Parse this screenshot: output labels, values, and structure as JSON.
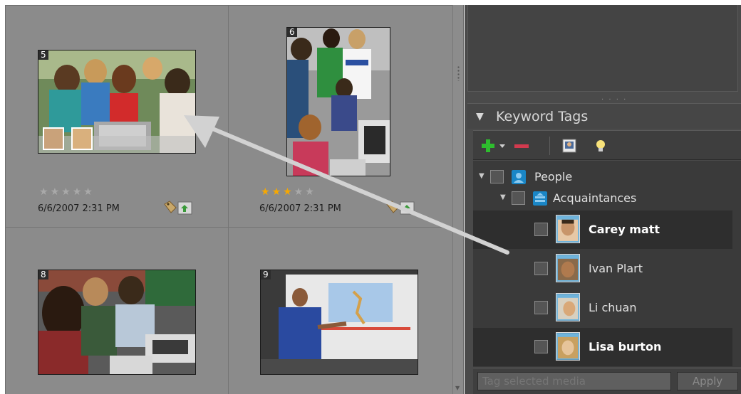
{
  "thumbnails": [
    {
      "number": "5",
      "rating": 0,
      "max_rating": 5,
      "date": "6/6/2007 2:31 PM"
    },
    {
      "number": "6",
      "rating": 3,
      "max_rating": 5,
      "date": "6/6/2007 2:31 PM"
    },
    {
      "number": "8"
    },
    {
      "number": "9"
    }
  ],
  "keyword_tags": {
    "title": "Keyword Tags",
    "categories": [
      {
        "label": "People"
      },
      {
        "label": "Acquaintances"
      }
    ],
    "people": [
      {
        "label": "Carey matt",
        "selected": true
      },
      {
        "label": "Ivan Plart",
        "selected": false
      },
      {
        "label": "Li chuan",
        "selected": false
      },
      {
        "label": "Lisa burton",
        "selected": true
      }
    ],
    "tag_input_placeholder": "Tag selected media",
    "apply_label": "Apply"
  },
  "colors": {
    "grid_bg": "#8b8b8b",
    "panel_bg": "#3a3a3a",
    "star_on": "#f7a800",
    "star_off": "#a9a9a9",
    "accent_blue": "#1a86c6",
    "add_green": "#2ebd2e",
    "remove_red": "#d23a4e"
  },
  "icons": [
    "expand-triangle-icon",
    "add-tag-icon",
    "dropdown-arrow-icon",
    "remove-tag-icon",
    "person-tag-icon",
    "lightbulb-icon",
    "tag-icon",
    "info-icon",
    "people-category-icon",
    "acquaintances-category-icon",
    "arrow-annotation"
  ]
}
